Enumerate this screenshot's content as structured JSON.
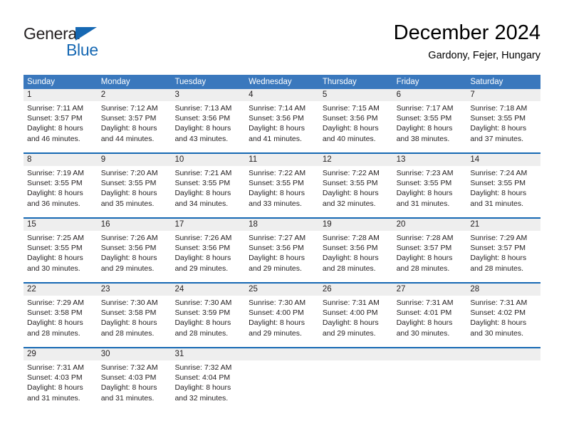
{
  "brand": {
    "line1": "General",
    "line2": "Blue",
    "triangle_color": "#1668b3",
    "text_color": "#231f20"
  },
  "header": {
    "title": "December 2024",
    "subtitle": "Gardony, Fejer, Hungary"
  },
  "colors": {
    "header_row_bg": "#3a78bd",
    "week_separator": "#1668b3",
    "daynum_bg": "#eeeeee",
    "text": "#231f20"
  },
  "weekdays": [
    "Sunday",
    "Monday",
    "Tuesday",
    "Wednesday",
    "Thursday",
    "Friday",
    "Saturday"
  ],
  "weeks": [
    [
      {
        "day": "1",
        "sunrise": "Sunrise: 7:11 AM",
        "sunset": "Sunset: 3:57 PM",
        "daylight1": "Daylight: 8 hours",
        "daylight2": "and 46 minutes."
      },
      {
        "day": "2",
        "sunrise": "Sunrise: 7:12 AM",
        "sunset": "Sunset: 3:57 PM",
        "daylight1": "Daylight: 8 hours",
        "daylight2": "and 44 minutes."
      },
      {
        "day": "3",
        "sunrise": "Sunrise: 7:13 AM",
        "sunset": "Sunset: 3:56 PM",
        "daylight1": "Daylight: 8 hours",
        "daylight2": "and 43 minutes."
      },
      {
        "day": "4",
        "sunrise": "Sunrise: 7:14 AM",
        "sunset": "Sunset: 3:56 PM",
        "daylight1": "Daylight: 8 hours",
        "daylight2": "and 41 minutes."
      },
      {
        "day": "5",
        "sunrise": "Sunrise: 7:15 AM",
        "sunset": "Sunset: 3:56 PM",
        "daylight1": "Daylight: 8 hours",
        "daylight2": "and 40 minutes."
      },
      {
        "day": "6",
        "sunrise": "Sunrise: 7:17 AM",
        "sunset": "Sunset: 3:55 PM",
        "daylight1": "Daylight: 8 hours",
        "daylight2": "and 38 minutes."
      },
      {
        "day": "7",
        "sunrise": "Sunrise: 7:18 AM",
        "sunset": "Sunset: 3:55 PM",
        "daylight1": "Daylight: 8 hours",
        "daylight2": "and 37 minutes."
      }
    ],
    [
      {
        "day": "8",
        "sunrise": "Sunrise: 7:19 AM",
        "sunset": "Sunset: 3:55 PM",
        "daylight1": "Daylight: 8 hours",
        "daylight2": "and 36 minutes."
      },
      {
        "day": "9",
        "sunrise": "Sunrise: 7:20 AM",
        "sunset": "Sunset: 3:55 PM",
        "daylight1": "Daylight: 8 hours",
        "daylight2": "and 35 minutes."
      },
      {
        "day": "10",
        "sunrise": "Sunrise: 7:21 AM",
        "sunset": "Sunset: 3:55 PM",
        "daylight1": "Daylight: 8 hours",
        "daylight2": "and 34 minutes."
      },
      {
        "day": "11",
        "sunrise": "Sunrise: 7:22 AM",
        "sunset": "Sunset: 3:55 PM",
        "daylight1": "Daylight: 8 hours",
        "daylight2": "and 33 minutes."
      },
      {
        "day": "12",
        "sunrise": "Sunrise: 7:22 AM",
        "sunset": "Sunset: 3:55 PM",
        "daylight1": "Daylight: 8 hours",
        "daylight2": "and 32 minutes."
      },
      {
        "day": "13",
        "sunrise": "Sunrise: 7:23 AM",
        "sunset": "Sunset: 3:55 PM",
        "daylight1": "Daylight: 8 hours",
        "daylight2": "and 31 minutes."
      },
      {
        "day": "14",
        "sunrise": "Sunrise: 7:24 AM",
        "sunset": "Sunset: 3:55 PM",
        "daylight1": "Daylight: 8 hours",
        "daylight2": "and 31 minutes."
      }
    ],
    [
      {
        "day": "15",
        "sunrise": "Sunrise: 7:25 AM",
        "sunset": "Sunset: 3:55 PM",
        "daylight1": "Daylight: 8 hours",
        "daylight2": "and 30 minutes."
      },
      {
        "day": "16",
        "sunrise": "Sunrise: 7:26 AM",
        "sunset": "Sunset: 3:56 PM",
        "daylight1": "Daylight: 8 hours",
        "daylight2": "and 29 minutes."
      },
      {
        "day": "17",
        "sunrise": "Sunrise: 7:26 AM",
        "sunset": "Sunset: 3:56 PM",
        "daylight1": "Daylight: 8 hours",
        "daylight2": "and 29 minutes."
      },
      {
        "day": "18",
        "sunrise": "Sunrise: 7:27 AM",
        "sunset": "Sunset: 3:56 PM",
        "daylight1": "Daylight: 8 hours",
        "daylight2": "and 29 minutes."
      },
      {
        "day": "19",
        "sunrise": "Sunrise: 7:28 AM",
        "sunset": "Sunset: 3:56 PM",
        "daylight1": "Daylight: 8 hours",
        "daylight2": "and 28 minutes."
      },
      {
        "day": "20",
        "sunrise": "Sunrise: 7:28 AM",
        "sunset": "Sunset: 3:57 PM",
        "daylight1": "Daylight: 8 hours",
        "daylight2": "and 28 minutes."
      },
      {
        "day": "21",
        "sunrise": "Sunrise: 7:29 AM",
        "sunset": "Sunset: 3:57 PM",
        "daylight1": "Daylight: 8 hours",
        "daylight2": "and 28 minutes."
      }
    ],
    [
      {
        "day": "22",
        "sunrise": "Sunrise: 7:29 AM",
        "sunset": "Sunset: 3:58 PM",
        "daylight1": "Daylight: 8 hours",
        "daylight2": "and 28 minutes."
      },
      {
        "day": "23",
        "sunrise": "Sunrise: 7:30 AM",
        "sunset": "Sunset: 3:58 PM",
        "daylight1": "Daylight: 8 hours",
        "daylight2": "and 28 minutes."
      },
      {
        "day": "24",
        "sunrise": "Sunrise: 7:30 AM",
        "sunset": "Sunset: 3:59 PM",
        "daylight1": "Daylight: 8 hours",
        "daylight2": "and 28 minutes."
      },
      {
        "day": "25",
        "sunrise": "Sunrise: 7:30 AM",
        "sunset": "Sunset: 4:00 PM",
        "daylight1": "Daylight: 8 hours",
        "daylight2": "and 29 minutes."
      },
      {
        "day": "26",
        "sunrise": "Sunrise: 7:31 AM",
        "sunset": "Sunset: 4:00 PM",
        "daylight1": "Daylight: 8 hours",
        "daylight2": "and 29 minutes."
      },
      {
        "day": "27",
        "sunrise": "Sunrise: 7:31 AM",
        "sunset": "Sunset: 4:01 PM",
        "daylight1": "Daylight: 8 hours",
        "daylight2": "and 30 minutes."
      },
      {
        "day": "28",
        "sunrise": "Sunrise: 7:31 AM",
        "sunset": "Sunset: 4:02 PM",
        "daylight1": "Daylight: 8 hours",
        "daylight2": "and 30 minutes."
      }
    ],
    [
      {
        "day": "29",
        "sunrise": "Sunrise: 7:31 AM",
        "sunset": "Sunset: 4:03 PM",
        "daylight1": "Daylight: 8 hours",
        "daylight2": "and 31 minutes."
      },
      {
        "day": "30",
        "sunrise": "Sunrise: 7:32 AM",
        "sunset": "Sunset: 4:03 PM",
        "daylight1": "Daylight: 8 hours",
        "daylight2": "and 31 minutes."
      },
      {
        "day": "31",
        "sunrise": "Sunrise: 7:32 AM",
        "sunset": "Sunset: 4:04 PM",
        "daylight1": "Daylight: 8 hours",
        "daylight2": "and 32 minutes."
      },
      {
        "day": "",
        "sunrise": "",
        "sunset": "",
        "daylight1": "",
        "daylight2": ""
      },
      {
        "day": "",
        "sunrise": "",
        "sunset": "",
        "daylight1": "",
        "daylight2": ""
      },
      {
        "day": "",
        "sunrise": "",
        "sunset": "",
        "daylight1": "",
        "daylight2": ""
      },
      {
        "day": "",
        "sunrise": "",
        "sunset": "",
        "daylight1": "",
        "daylight2": ""
      }
    ]
  ]
}
